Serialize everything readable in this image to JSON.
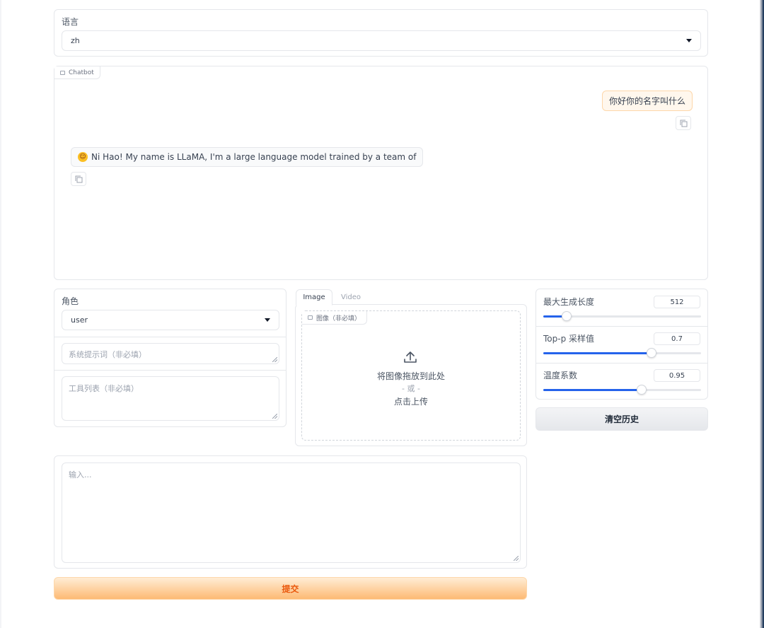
{
  "language": {
    "label": "语言",
    "value": "zh"
  },
  "chatbot": {
    "label": "Chatbot",
    "messages": [
      {
        "role": "user",
        "text": "你好你的名字叫什么"
      },
      {
        "role": "bot",
        "text": "Ni Hao! My name is LLaMA, I'm a large language model trained by a team of"
      }
    ]
  },
  "role": {
    "label": "角色",
    "value": "user"
  },
  "system_prompt": {
    "placeholder": "系统提示词（非必填）"
  },
  "tools": {
    "placeholder": "工具列表（非必填）"
  },
  "media_tabs": [
    {
      "label": "Image"
    },
    {
      "label": "Video"
    }
  ],
  "image_upload": {
    "label": "图像（非必填）",
    "drop_text": "将图像拖放到此处",
    "or_text": "- 或 -",
    "click_text": "点击上传"
  },
  "params": [
    {
      "label": "最大生成长度",
      "value": "512",
      "fraction": 0.15
    },
    {
      "label": "Top-p 采样值",
      "value": "0.7",
      "fraction": 0.685
    },
    {
      "label": "温度系数",
      "value": "0.95",
      "fraction": 0.625
    }
  ],
  "clear_button": "清空历史",
  "input": {
    "placeholder": "输入..."
  },
  "submit_button": "提交",
  "colors": {
    "accent": "#2563eb",
    "submit_text": "#ea580c",
    "user_bubble": "#fff7ed"
  }
}
